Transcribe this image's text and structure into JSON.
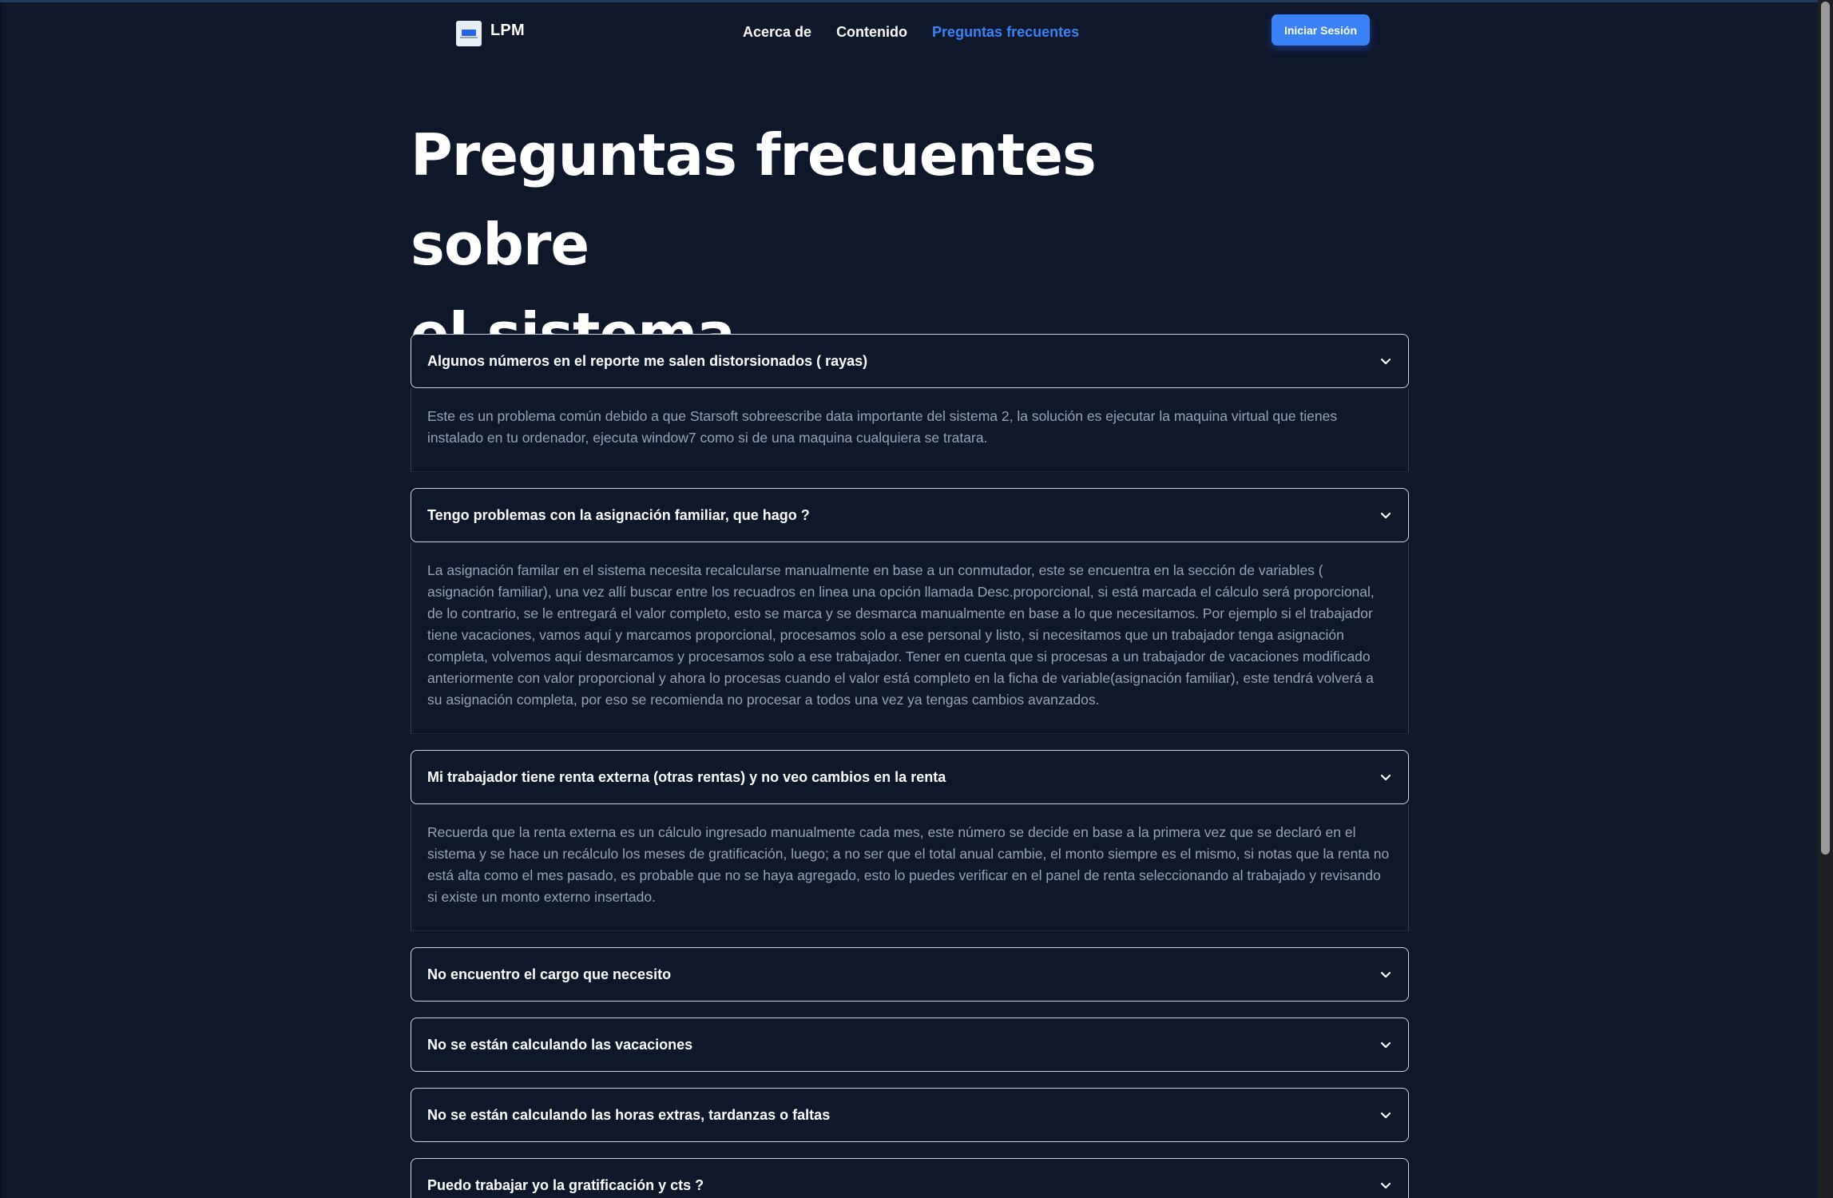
{
  "brand": {
    "name": "LPM",
    "logo_icon": "lpm-logo-icon"
  },
  "nav": {
    "links": [
      {
        "label": "Acerca de",
        "active": false
      },
      {
        "label": "Contenido",
        "active": false
      },
      {
        "label": "Preguntas frecuentes",
        "active": true
      }
    ],
    "login_label": "Iniciar Sesión"
  },
  "page": {
    "title_line1": "Preguntas frecuentes sobre",
    "title_line2": "el sistema"
  },
  "faq": [
    {
      "question": "Algunos números en el reporte me salen distorsionados ( rayas)",
      "expanded": true,
      "answer": "Este es un problema común debido a que Starsoft sobreescribe data importante del sistema 2, la solución es ejecutar la maquina virtual que tienes instalado en tu ordenador, ejecuta window7 como si de una maquina cualquiera se tratara."
    },
    {
      "question": "Tengo problemas con la asignación familiar, que hago ?",
      "expanded": true,
      "answer": "La asignación familar en el sistema necesita recalcularse manualmente en base a un conmutador, este se encuentra en la sección de variables ( asignación familiar), una vez allí buscar entre los recuadros en linea una opción llamada Desc.proporcional, si está marcada el cálculo será proporcional, de lo contrario, se le entregará el valor completo, esto se marca y se desmarca manualmente en base a lo que necesitamos. Por ejemplo si el trabajador tiene vacaciones, vamos aquí y marcamos proporcional, procesamos solo a ese personal y listo, si necesitamos que un trabajador tenga asignación completa, volvemos aquí desmarcamos y procesamos solo a ese trabajador. Tener en cuenta que si procesas a un trabajador de vacaciones modificado anteriormente con valor proporcional y ahora lo procesas cuando el valor está completo en la ficha de variable(asignación familiar), este tendrá volverá a su asignación completa, por eso se recomienda no procesar a todos una vez ya tengas cambios avanzados."
    },
    {
      "question": "Mi trabajador tiene renta externa (otras rentas) y no veo cambios en la renta",
      "expanded": true,
      "answer": "Recuerda que la renta externa es un cálculo ingresado manualmente cada mes, este número se decide en base a la primera vez que se declaró en el sistema y se hace un recálculo los meses de gratificación, luego; a no ser que el total anual cambie, el monto siempre es el mismo, si notas que la renta no está alta como el mes pasado, es probable que no se haya agregado, esto lo puedes verificar en el panel de renta seleccionando al trabajado y revisando si existe un monto externo insertado."
    },
    {
      "question": "No encuentro el cargo que necesito",
      "expanded": false,
      "answer": ""
    },
    {
      "question": "No se están calculando las vacaciones",
      "expanded": false,
      "answer": ""
    },
    {
      "question": "No se están calculando las horas extras, tardanzas o faltas",
      "expanded": false,
      "answer": ""
    },
    {
      "question": "Puedo trabajar yo la gratificación y cts ?",
      "expanded": false,
      "answer": ""
    }
  ],
  "icons": {
    "chevron": "chevron-down-icon"
  },
  "colors": {
    "background": "#0f172a",
    "accent": "#3b82f6",
    "answer_text": "#94a3b8",
    "border": "#cbd5e1"
  }
}
